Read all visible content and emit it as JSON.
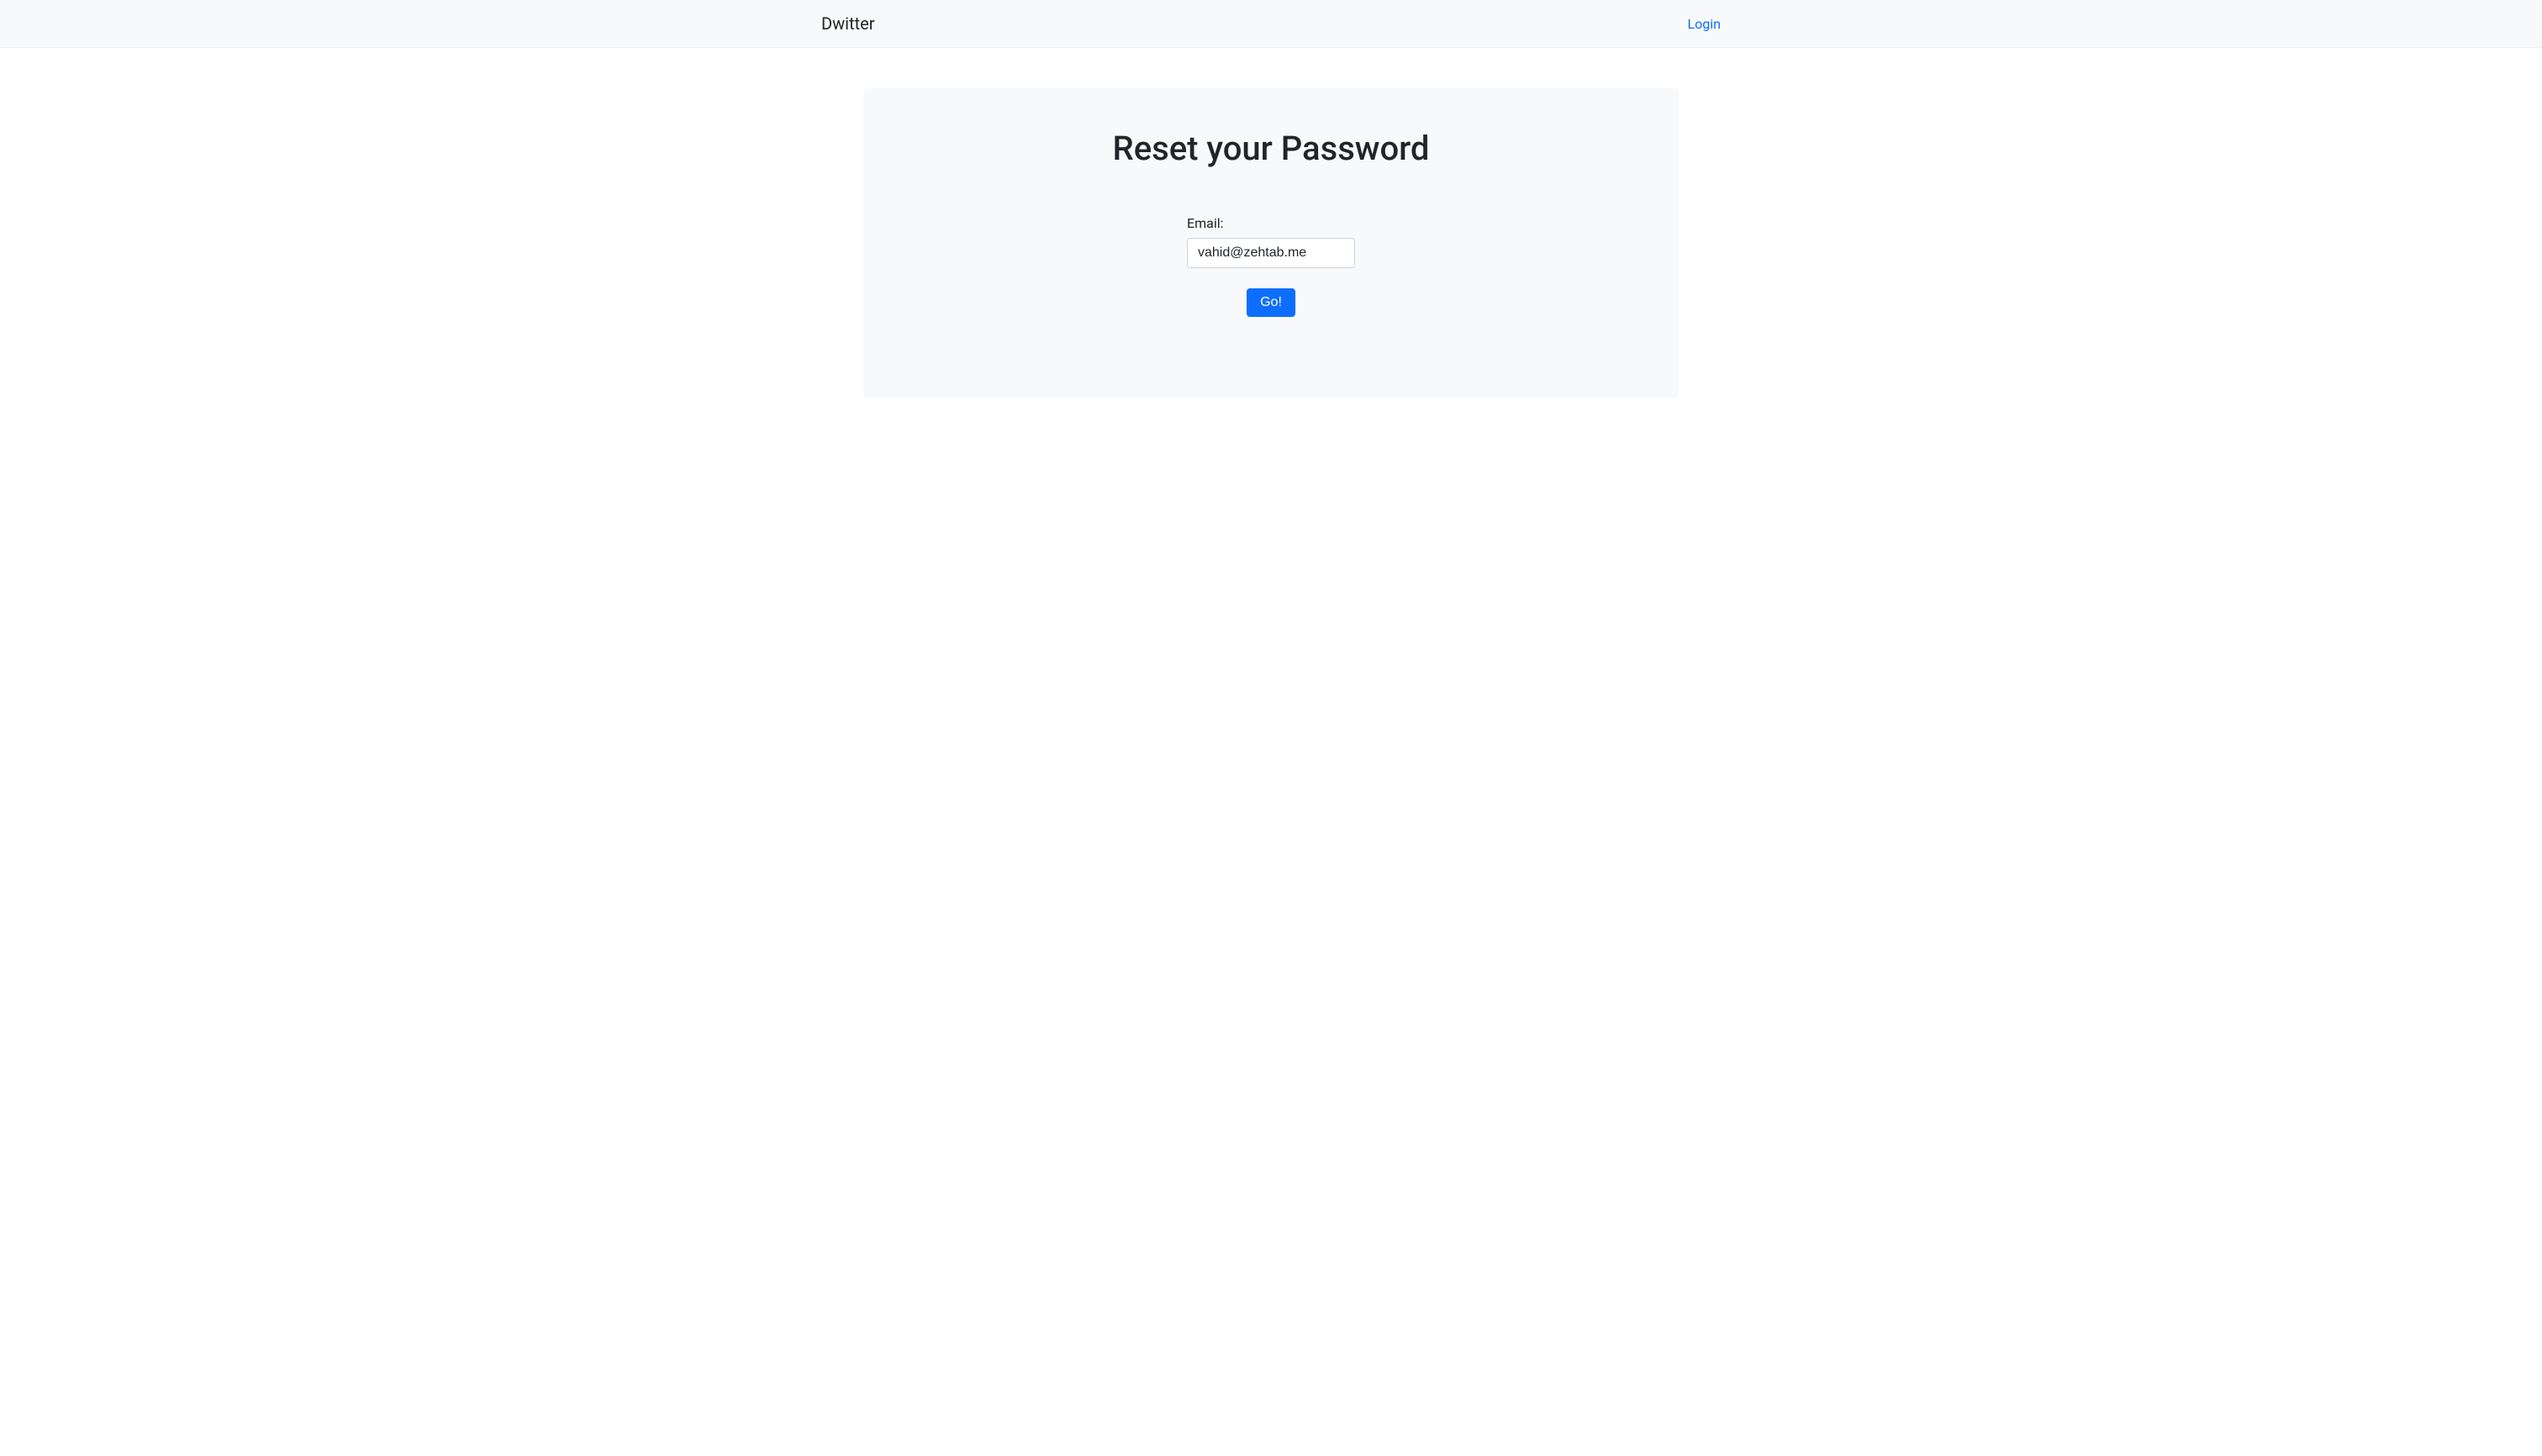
{
  "navbar": {
    "brand": "Dwitter",
    "login_link": "Login"
  },
  "card": {
    "title": "Reset your Password",
    "form": {
      "email_label": "Email:",
      "email_value": "vahid@zehtab.me",
      "submit_label": "Go!"
    }
  }
}
